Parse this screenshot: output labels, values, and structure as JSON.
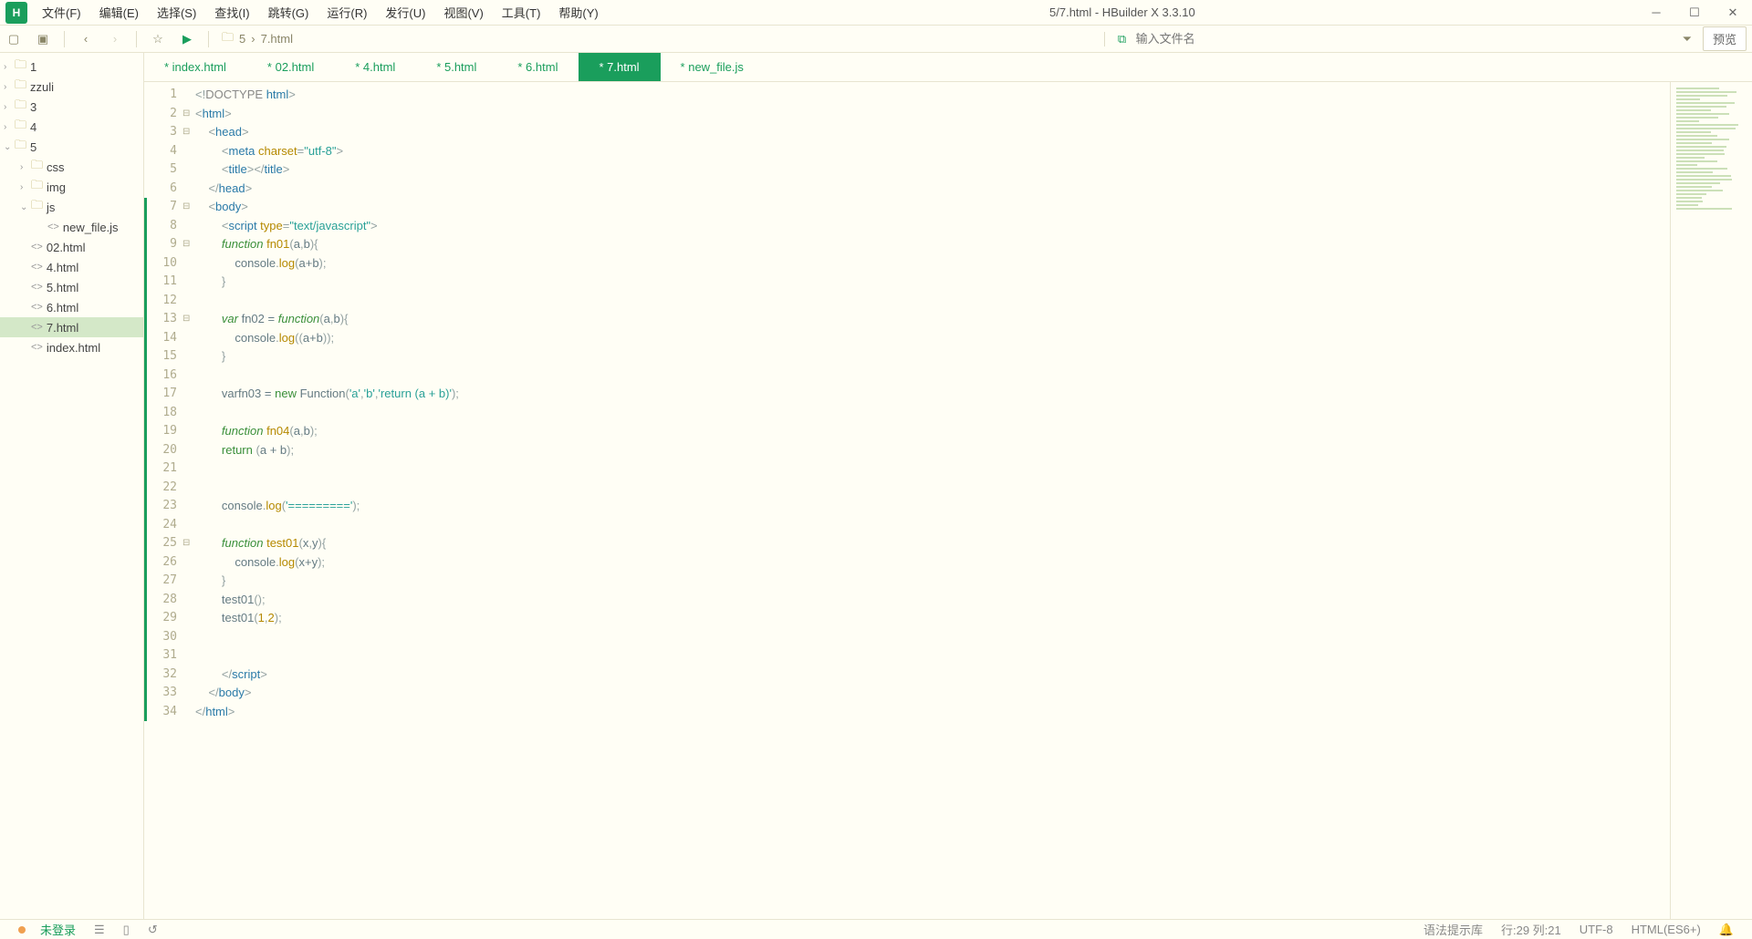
{
  "window": {
    "title": "5/7.html - HBuilder X 3.3.10",
    "logo": "H"
  },
  "menus": [
    "文件(F)",
    "编辑(E)",
    "选择(S)",
    "查找(I)",
    "跳转(G)",
    "运行(R)",
    "发行(U)",
    "视图(V)",
    "工具(T)",
    "帮助(Y)"
  ],
  "toolbar": {
    "search_placeholder": "输入文件名",
    "preview_label": "预览",
    "crumbs": [
      "5",
      "7.html"
    ]
  },
  "sidebar": {
    "items": [
      {
        "depth": 0,
        "chev": "›",
        "icon": "folder",
        "label": "1"
      },
      {
        "depth": 0,
        "chev": "›",
        "icon": "folder",
        "label": "zzuli"
      },
      {
        "depth": 0,
        "chev": "›",
        "icon": "folder",
        "label": "3"
      },
      {
        "depth": 0,
        "chev": "›",
        "icon": "folder",
        "label": "4"
      },
      {
        "depth": 0,
        "chev": "⌄",
        "icon": "folder",
        "label": "5"
      },
      {
        "depth": 1,
        "chev": "›",
        "icon": "folder",
        "label": "css"
      },
      {
        "depth": 1,
        "chev": "›",
        "icon": "folder",
        "label": "img"
      },
      {
        "depth": 1,
        "chev": "⌄",
        "icon": "folder",
        "label": "js"
      },
      {
        "depth": 2,
        "chev": "",
        "icon": "file",
        "label": "new_file.js"
      },
      {
        "depth": 1,
        "chev": "",
        "icon": "file",
        "label": "02.html"
      },
      {
        "depth": 1,
        "chev": "",
        "icon": "file",
        "label": "4.html"
      },
      {
        "depth": 1,
        "chev": "",
        "icon": "file",
        "label": "5.html"
      },
      {
        "depth": 1,
        "chev": "",
        "icon": "file",
        "label": "6.html"
      },
      {
        "depth": 1,
        "chev": "",
        "icon": "file",
        "label": "7.html",
        "selected": true
      },
      {
        "depth": 1,
        "chev": "",
        "icon": "file",
        "label": "index.html"
      }
    ]
  },
  "tabs": [
    {
      "label": "* index.html"
    },
    {
      "label": "* 02.html"
    },
    {
      "label": "* 4.html"
    },
    {
      "label": "* 5.html"
    },
    {
      "label": "* 6.html"
    },
    {
      "label": "* 7.html",
      "active": true
    },
    {
      "label": "* new_file.js"
    }
  ],
  "code": {
    "total_lines": 34,
    "fold_lines": [
      2,
      3,
      7,
      9,
      13,
      25
    ],
    "mod_start": 7,
    "mod_end": 34,
    "lines": [
      [
        [
          "c-punc",
          "<!"
        ],
        [
          "c-decl",
          "DOCTYPE "
        ],
        [
          "c-tag",
          "html"
        ],
        [
          "c-punc",
          ">"
        ]
      ],
      [
        [
          "c-punc",
          "<"
        ],
        [
          "c-tag",
          "html"
        ],
        [
          "c-punc",
          ">"
        ]
      ],
      [
        [
          "",
          "    "
        ],
        [
          "c-punc",
          "<"
        ],
        [
          "c-tag",
          "head"
        ],
        [
          "c-punc",
          ">"
        ]
      ],
      [
        [
          "",
          "        "
        ],
        [
          "c-punc",
          "<"
        ],
        [
          "c-tag",
          "meta "
        ],
        [
          "c-attr",
          "charset"
        ],
        [
          "c-punc",
          "="
        ],
        [
          "c-str",
          "\"utf-8\""
        ],
        [
          "c-punc",
          ">"
        ]
      ],
      [
        [
          "",
          "        "
        ],
        [
          "c-punc",
          "<"
        ],
        [
          "c-tag",
          "title"
        ],
        [
          "c-punc",
          "></"
        ],
        [
          "c-tag",
          "title"
        ],
        [
          "c-punc",
          ">"
        ]
      ],
      [
        [
          "",
          "    "
        ],
        [
          "c-punc",
          "</"
        ],
        [
          "c-tag",
          "head"
        ],
        [
          "c-punc",
          ">"
        ]
      ],
      [
        [
          "",
          "    "
        ],
        [
          "c-punc",
          "<"
        ],
        [
          "c-tag",
          "body"
        ],
        [
          "c-punc",
          ">"
        ]
      ],
      [
        [
          "",
          "        "
        ],
        [
          "c-punc",
          "<"
        ],
        [
          "c-tag",
          "script "
        ],
        [
          "c-attr",
          "type"
        ],
        [
          "c-punc",
          "="
        ],
        [
          "c-str",
          "\"text/javascript\""
        ],
        [
          "c-punc",
          ">"
        ]
      ],
      [
        [
          "",
          "        "
        ],
        [
          "c-kw",
          "function"
        ],
        [
          "",
          " "
        ],
        [
          "c-fn",
          "fn01"
        ],
        [
          "c-punc",
          "("
        ],
        [
          "c-id",
          "a"
        ],
        [
          "c-punc",
          ","
        ],
        [
          "c-id",
          "b"
        ],
        [
          "c-punc",
          ")"
        ],
        [
          "c-punc",
          "{"
        ]
      ],
      [
        [
          "",
          "            "
        ],
        [
          "c-id",
          "console"
        ],
        [
          "c-punc",
          "."
        ],
        [
          "c-fn",
          "log"
        ],
        [
          "c-punc",
          "("
        ],
        [
          "c-id",
          "a"
        ],
        [
          "c-op",
          "+"
        ],
        [
          "c-id",
          "b"
        ],
        [
          "c-punc",
          ");"
        ]
      ],
      [
        [
          "",
          "        "
        ],
        [
          "c-punc",
          "}"
        ]
      ],
      [
        [
          "",
          ""
        ]
      ],
      [
        [
          "",
          "        "
        ],
        [
          "c-kw",
          "var"
        ],
        [
          "",
          " "
        ],
        [
          "c-id",
          "fn02"
        ],
        [
          "",
          " "
        ],
        [
          "c-op",
          "="
        ],
        [
          "",
          " "
        ],
        [
          "c-kw",
          "function"
        ],
        [
          "c-punc",
          "("
        ],
        [
          "c-id",
          "a"
        ],
        [
          "c-punc",
          ","
        ],
        [
          "c-id",
          "b"
        ],
        [
          "c-punc",
          ")"
        ],
        [
          "c-punc",
          "{"
        ]
      ],
      [
        [
          "",
          "            "
        ],
        [
          "c-id",
          "console"
        ],
        [
          "c-punc",
          "."
        ],
        [
          "c-fn",
          "log"
        ],
        [
          "c-punc",
          "(("
        ],
        [
          "c-id",
          "a"
        ],
        [
          "c-op",
          "+"
        ],
        [
          "c-id",
          "b"
        ],
        [
          "c-punc",
          "));"
        ]
      ],
      [
        [
          "",
          "        "
        ],
        [
          "c-punc",
          "}"
        ]
      ],
      [
        [
          "",
          ""
        ]
      ],
      [
        [
          "",
          "        "
        ],
        [
          "c-id",
          "var"
        ],
        [
          "c-id",
          "fn03"
        ],
        [
          "",
          " "
        ],
        [
          "c-op",
          "="
        ],
        [
          "",
          " "
        ],
        [
          "c-kw2",
          "new"
        ],
        [
          "",
          " "
        ],
        [
          "c-id",
          "Function"
        ],
        [
          "c-punc",
          "("
        ],
        [
          "c-str",
          "'a'"
        ],
        [
          "c-punc",
          ","
        ],
        [
          "c-str",
          "'b'"
        ],
        [
          "c-punc",
          ","
        ],
        [
          "c-str",
          "'return (a + b)'"
        ],
        [
          "c-punc",
          ");"
        ]
      ],
      [
        [
          "",
          ""
        ]
      ],
      [
        [
          "",
          "        "
        ],
        [
          "c-kw",
          "function"
        ],
        [
          "",
          " "
        ],
        [
          "c-fn",
          "fn04"
        ],
        [
          "c-punc",
          "("
        ],
        [
          "c-id",
          "a"
        ],
        [
          "c-punc",
          ","
        ],
        [
          "c-id",
          "b"
        ],
        [
          "c-punc",
          ");"
        ]
      ],
      [
        [
          "",
          "        "
        ],
        [
          "c-kw2",
          "return"
        ],
        [
          "",
          " "
        ],
        [
          "c-punc",
          "("
        ],
        [
          "c-id",
          "a"
        ],
        [
          "",
          " "
        ],
        [
          "c-op",
          "+"
        ],
        [
          "",
          " "
        ],
        [
          "c-id",
          "b"
        ],
        [
          "c-punc",
          ");"
        ]
      ],
      [
        [
          "",
          ""
        ]
      ],
      [
        [
          "",
          ""
        ]
      ],
      [
        [
          "",
          "        "
        ],
        [
          "c-id",
          "console"
        ],
        [
          "c-punc",
          "."
        ],
        [
          "c-fn",
          "log"
        ],
        [
          "c-punc",
          "("
        ],
        [
          "c-str",
          "'========='"
        ],
        [
          "c-punc",
          ");"
        ]
      ],
      [
        [
          "",
          ""
        ]
      ],
      [
        [
          "",
          "        "
        ],
        [
          "c-kw",
          "function"
        ],
        [
          "",
          " "
        ],
        [
          "c-fn",
          "test01"
        ],
        [
          "c-punc",
          "("
        ],
        [
          "c-id",
          "x"
        ],
        [
          "c-punc",
          ","
        ],
        [
          "c-id",
          "y"
        ],
        [
          "c-punc",
          ")"
        ],
        [
          "c-punc",
          "{"
        ]
      ],
      [
        [
          "",
          "            "
        ],
        [
          "c-id",
          "console"
        ],
        [
          "c-punc",
          "."
        ],
        [
          "c-fn",
          "log"
        ],
        [
          "c-punc",
          "("
        ],
        [
          "c-id",
          "x"
        ],
        [
          "c-op",
          "+"
        ],
        [
          "c-id",
          "y"
        ],
        [
          "c-punc",
          ");"
        ]
      ],
      [
        [
          "",
          "        "
        ],
        [
          "c-punc",
          "}"
        ]
      ],
      [
        [
          "",
          "        "
        ],
        [
          "c-id",
          "test01"
        ],
        [
          "c-punc",
          "();"
        ]
      ],
      [
        [
          "",
          "        "
        ],
        [
          "c-id",
          "test01"
        ],
        [
          "c-punc",
          "("
        ],
        [
          "c-num",
          "1"
        ],
        [
          "c-punc",
          ","
        ],
        [
          "c-num",
          "2"
        ],
        [
          "c-punc",
          ");"
        ]
      ],
      [
        [
          "",
          ""
        ]
      ],
      [
        [
          "",
          ""
        ]
      ],
      [
        [
          "",
          "        "
        ],
        [
          "c-punc",
          "</"
        ],
        [
          "c-tag",
          "script"
        ],
        [
          "c-punc",
          ">"
        ]
      ],
      [
        [
          "",
          "    "
        ],
        [
          "c-punc",
          "</"
        ],
        [
          "c-tag",
          "body"
        ],
        [
          "c-punc",
          ">"
        ]
      ],
      [
        [
          "c-punc",
          "</"
        ],
        [
          "c-tag",
          "html"
        ],
        [
          "c-punc",
          ">"
        ]
      ]
    ]
  },
  "status": {
    "login": "未登录",
    "hint_lib": "语法提示库",
    "cursor": "行:29  列:21",
    "encoding": "UTF-8",
    "lang": "HTML(ES6+)"
  }
}
